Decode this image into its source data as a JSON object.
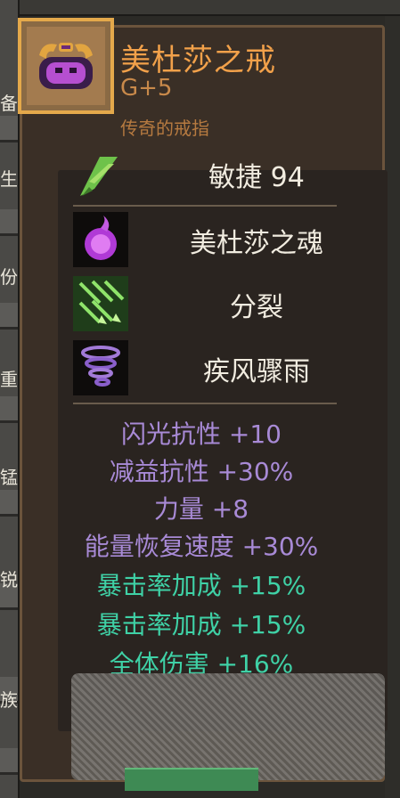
{
  "left_strip": {
    "chars": [
      "备",
      "生",
      "份",
      "重",
      "锰",
      "锐",
      "族"
    ]
  },
  "item": {
    "name": "美杜莎之戒",
    "grade": "G+5",
    "rarity": "传奇的戒指",
    "icon": "medusa-ring-icon"
  },
  "main_stat": {
    "icon": "agility-feather-icon",
    "label": "敏捷 94"
  },
  "skills": [
    {
      "icon": "medusa-soul-icon",
      "label": "美杜莎之魂"
    },
    {
      "icon": "split-arrows-icon",
      "label": "分裂"
    },
    {
      "icon": "tornado-icon",
      "label": "疾风骤雨"
    }
  ],
  "attributes": [
    {
      "text": "闪光抗性 +10",
      "color": "#a88ad6"
    },
    {
      "text": "减益抗性 +30%",
      "color": "#a88ad6"
    },
    {
      "text": "力量 +8",
      "color": "#a88ad6"
    },
    {
      "text": "能量恢复速度 +30%",
      "color": "#a88ad6"
    },
    {
      "text": "暴击率加成 +15%",
      "color": "#3fd1a6"
    },
    {
      "text": "暴击率加成 +15%",
      "color": "#3fd1a6"
    },
    {
      "text": "全体伤害 +16%",
      "color": "#3fd1a6"
    }
  ],
  "colors": {
    "title": "#f2a14a",
    "rarity": "#b67a40",
    "panel_border": "#6b543c",
    "icon_frame": "#e4a94b"
  }
}
